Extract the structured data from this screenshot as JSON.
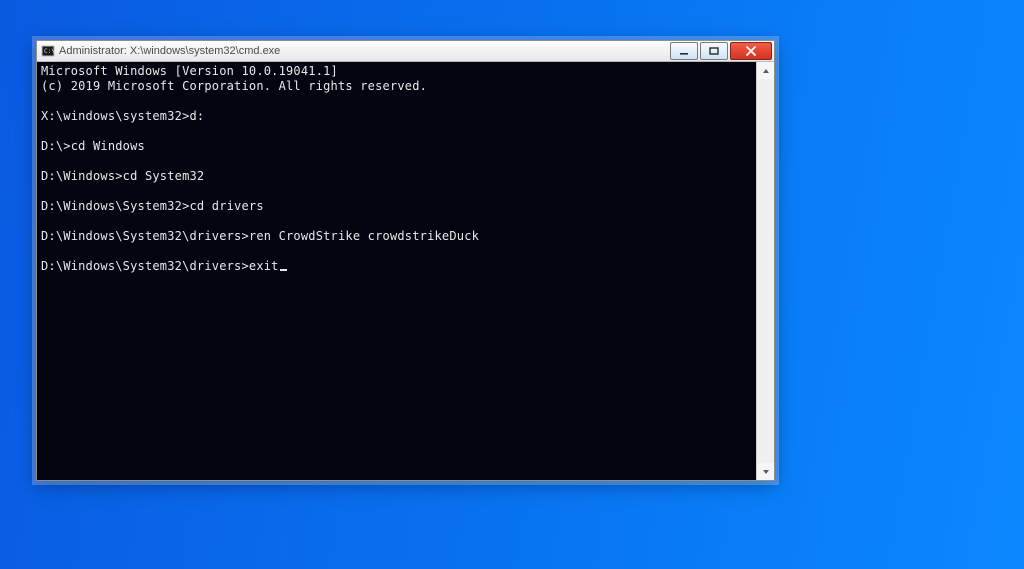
{
  "window": {
    "title": "Administrator: X:\\windows\\system32\\cmd.exe"
  },
  "terminal": {
    "lines": [
      "Microsoft Windows [Version 10.0.19041.1]",
      "(c) 2019 Microsoft Corporation. All rights reserved.",
      "",
      "X:\\windows\\system32>d:",
      "",
      "D:\\>cd Windows",
      "",
      "D:\\Windows>cd System32",
      "",
      "D:\\Windows\\System32>cd drivers",
      "",
      "D:\\Windows\\System32\\drivers>ren CrowdStrike crowdstrikeDuck",
      "",
      "D:\\Windows\\System32\\drivers>exit"
    ],
    "cursor_after_last": true
  }
}
